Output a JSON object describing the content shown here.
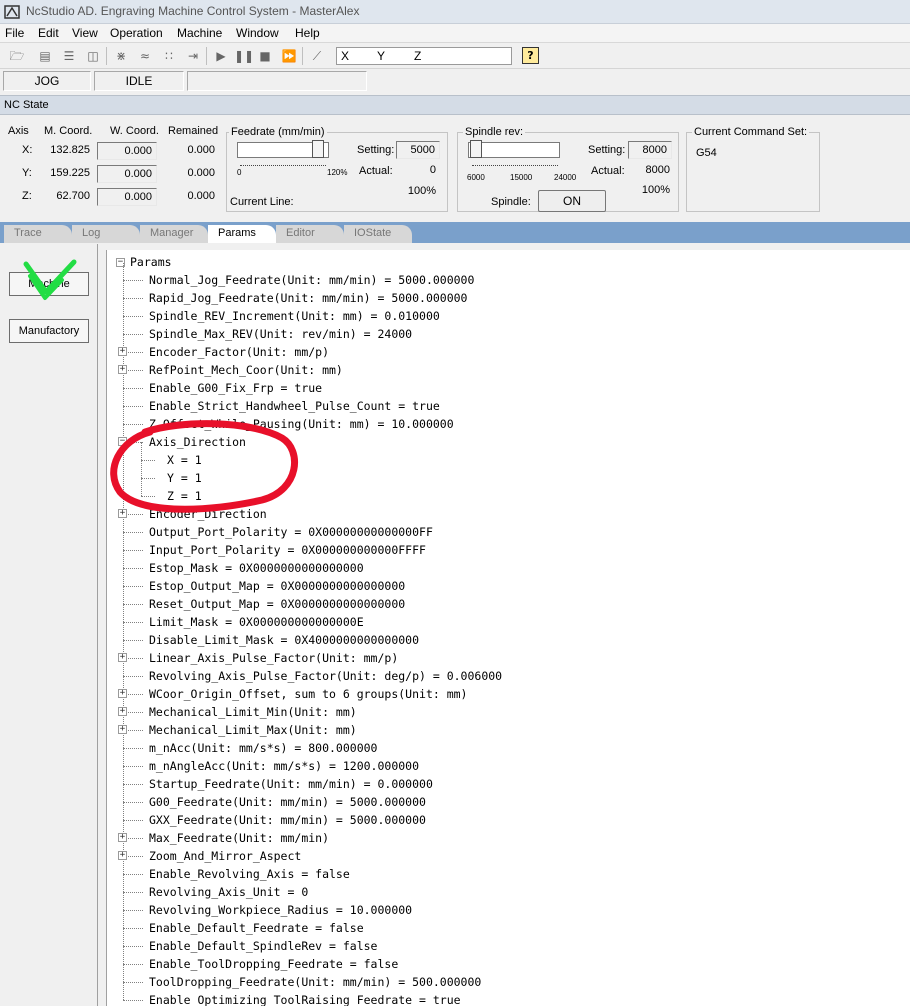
{
  "window": {
    "title": "NcStudio AD. Engraving Machine Control System - MasterAlex"
  },
  "menu": [
    "File",
    "Edit",
    "View",
    "Operation",
    "Machine",
    "Window",
    "Help"
  ],
  "toolbar": {
    "coord_x": "X",
    "coord_y": "Y",
    "coord_z": "Z",
    "help": "?"
  },
  "status": {
    "mode": "JOG",
    "state": "IDLE",
    "extra": ""
  },
  "nc_state": {
    "header": "NC State",
    "axes_header": "Axis",
    "mcoord_header": "M. Coord.",
    "wcoord_header": "W. Coord.",
    "remained_header": "Remained",
    "axes": [
      {
        "name": "X:",
        "mcoord": "132.825",
        "wcoord": "0.000",
        "remained": "0.000"
      },
      {
        "name": "Y:",
        "mcoord": "159.225",
        "wcoord": "0.000",
        "remained": "0.000"
      },
      {
        "name": "Z:",
        "mcoord": "62.700",
        "wcoord": "0.000",
        "remained": "0.000"
      }
    ],
    "feedrate": {
      "title": "Feedrate (mm/min)",
      "setting_label": "Setting:",
      "setting": "5000",
      "actual_label": "Actual:",
      "actual": "0",
      "percent": "100%",
      "scale_min": "0",
      "scale_max": "120%",
      "current_line_label": "Current Line:",
      "current_line": ""
    },
    "spindle": {
      "title": "Spindle rev:",
      "setting_label": "Setting:",
      "setting": "8000",
      "actual_label": "Actual:",
      "actual": "8000",
      "percent": "100%",
      "scale": [
        "6000",
        "15000",
        "24000"
      ],
      "spindle_label": "Spindle:",
      "button": "ON"
    },
    "command_set": {
      "title": "Current Command Set:",
      "value": "G54"
    }
  },
  "tabs": [
    {
      "label": "Trace",
      "active": false
    },
    {
      "label": "Log",
      "active": false
    },
    {
      "label": "Manager",
      "active": false
    },
    {
      "label": "Params",
      "active": true
    },
    {
      "label": "Editor",
      "active": false
    },
    {
      "label": "IOState",
      "active": false
    }
  ],
  "left_panel": {
    "btn_machine": "Machine",
    "btn_manufactory": "Manufactory"
  },
  "tree": {
    "root": "Params",
    "items": [
      {
        "text": "Normal_Jog_Feedrate(Unit: mm/min) = 5000.000000",
        "exp": false,
        "child": false
      },
      {
        "text": "Rapid_Jog_Feedrate(Unit: mm/min) = 5000.000000",
        "exp": false,
        "child": false
      },
      {
        "text": "Spindle_REV_Increment(Unit: mm) = 0.010000",
        "exp": false,
        "child": false
      },
      {
        "text": "Spindle_Max_REV(Unit: rev/min) = 24000",
        "exp": false,
        "child": false
      },
      {
        "text": "Encoder_Factor(Unit: mm/p)",
        "exp": "plus",
        "child": false
      },
      {
        "text": "RefPoint_Mech_Coor(Unit: mm)",
        "exp": "plus",
        "child": false
      },
      {
        "text": "Enable_G00_Fix_Frp = true",
        "exp": false,
        "child": false
      },
      {
        "text": "Enable_Strict_Handwheel_Pulse_Count = true",
        "exp": false,
        "child": false
      },
      {
        "text": "Z_Offset_While_Pausing(Unit: mm) = 10.000000",
        "exp": false,
        "child": false
      },
      {
        "text": "Axis_Direction",
        "exp": "minus",
        "child": false
      },
      {
        "text": "X = 1",
        "exp": false,
        "child": true
      },
      {
        "text": "Y = 1",
        "exp": false,
        "child": true
      },
      {
        "text": "Z = 1",
        "exp": false,
        "child": true
      },
      {
        "text": "Encoder_Direction",
        "exp": "plus",
        "child": false
      },
      {
        "text": "Output_Port_Polarity = 0X00000000000000FF",
        "exp": false,
        "child": false
      },
      {
        "text": "Input_Port_Polarity = 0X000000000000FFFF",
        "exp": false,
        "child": false
      },
      {
        "text": "Estop_Mask = 0X0000000000000000",
        "exp": false,
        "child": false
      },
      {
        "text": "Estop_Output_Map = 0X0000000000000000",
        "exp": false,
        "child": false
      },
      {
        "text": "Reset_Output_Map = 0X0000000000000000",
        "exp": false,
        "child": false
      },
      {
        "text": "Limit_Mask = 0X000000000000000E",
        "exp": false,
        "child": false
      },
      {
        "text": "Disable_Limit_Mask = 0X4000000000000000",
        "exp": false,
        "child": false
      },
      {
        "text": "Linear_Axis_Pulse_Factor(Unit: mm/p)",
        "exp": "plus",
        "child": false
      },
      {
        "text": "Revolving_Axis_Pulse_Factor(Unit: deg/p) = 0.006000",
        "exp": false,
        "child": false
      },
      {
        "text": "WCoor_Origin_Offset, sum to 6 groups(Unit: mm)",
        "exp": "plus",
        "child": false
      },
      {
        "text": "Mechanical_Limit_Min(Unit: mm)",
        "exp": "plus",
        "child": false
      },
      {
        "text": "Mechanical_Limit_Max(Unit: mm)",
        "exp": "plus",
        "child": false
      },
      {
        "text": "m_nAcc(Unit: mm/s*s) = 800.000000",
        "exp": false,
        "child": false
      },
      {
        "text": "m_nAngleAcc(Unit: mm/s*s) = 1200.000000",
        "exp": false,
        "child": false
      },
      {
        "text": "Startup_Feedrate(Unit: mm/min) = 0.000000",
        "exp": false,
        "child": false
      },
      {
        "text": "G00_Feedrate(Unit: mm/min) = 5000.000000",
        "exp": false,
        "child": false
      },
      {
        "text": "GXX_Feedrate(Unit: mm/min) = 5000.000000",
        "exp": false,
        "child": false
      },
      {
        "text": "Max_Feedrate(Unit: mm/min)",
        "exp": "plus",
        "child": false
      },
      {
        "text": "Zoom_And_Mirror_Aspect",
        "exp": "plus",
        "child": false
      },
      {
        "text": "Enable_Revolving_Axis = false",
        "exp": false,
        "child": false
      },
      {
        "text": "Revolving_Axis_Unit = 0",
        "exp": false,
        "child": false
      },
      {
        "text": "Revolving_Workpiece_Radius = 10.000000",
        "exp": false,
        "child": false
      },
      {
        "text": "Enable_Default_Feedrate = false",
        "exp": false,
        "child": false
      },
      {
        "text": "Enable_Default_SpindleRev = false",
        "exp": false,
        "child": false
      },
      {
        "text": "Enable_ToolDropping_Feedrate = false",
        "exp": false,
        "child": false
      },
      {
        "text": "ToolDropping_Feedrate(Unit: mm/min) = 500.000000",
        "exp": false,
        "child": false
      },
      {
        "text": "Enable_Optimizing_ToolRaising_Feedrate = true",
        "exp": false,
        "child": false
      }
    ]
  },
  "annotations": {
    "circle_color": "#e8102a",
    "check_color": "#22dd44"
  }
}
